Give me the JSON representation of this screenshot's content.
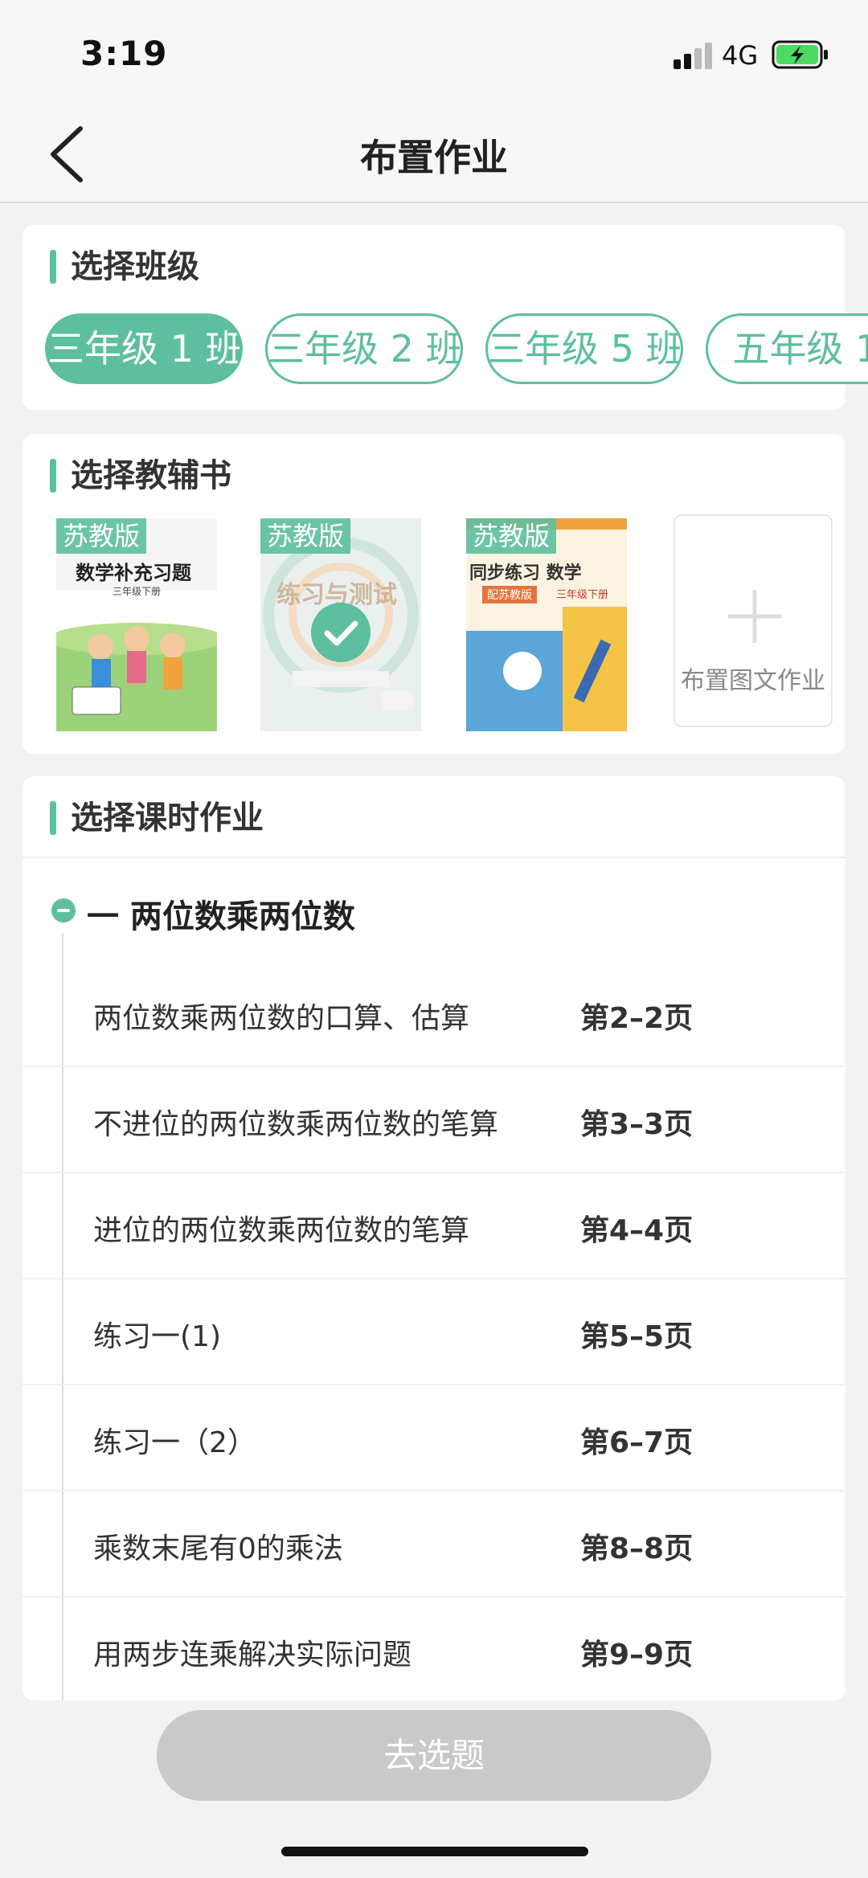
{
  "status_bar": {
    "time": "3:19",
    "network": "4G",
    "signal_icon": "signal-bars-icon",
    "battery_icon": "battery-charging-icon",
    "battery_color": "#4cd964"
  },
  "nav": {
    "title": "布置作业",
    "back_icon": "chevron-left-icon"
  },
  "colors": {
    "accent": "#5dbf9f",
    "button_disabled": "#c9c9c9"
  },
  "class_section": {
    "title": "选择班级",
    "classes": [
      {
        "label": "三年级 1 班",
        "selected": true
      },
      {
        "label": "三年级 2 班",
        "selected": false
      },
      {
        "label": "三年级 5 班",
        "selected": false
      },
      {
        "label": "五年级 1",
        "selected": false
      }
    ]
  },
  "book_section": {
    "title": "选择教辅书",
    "books": [
      {
        "badge": "苏教版",
        "cover_title": "数学补充习题",
        "cover_subtitle": "三年级下册",
        "selected": false
      },
      {
        "badge": "苏教版",
        "cover_title": "练习与测试",
        "selected": true
      },
      {
        "badge": "苏教版",
        "cover_title": "同步练习 数学",
        "cover_subtitle": "三年级下册",
        "cover_tag": "配苏教版",
        "selected": false
      }
    ],
    "add_label": "布置图文作业",
    "add_icon": "plus-icon"
  },
  "lesson_section": {
    "title": "选择课时作业",
    "unit_icon": "collapse-minus-icon",
    "unit_title": "一 两位数乘两位数",
    "lessons": [
      {
        "name": "两位数乘两位数的口算、估算",
        "pages": "第2–2页"
      },
      {
        "name": "不进位的两位数乘两位数的笔算",
        "pages": "第3–3页"
      },
      {
        "name": "进位的两位数乘两位数的笔算",
        "pages": "第4–4页"
      },
      {
        "name": "练习一(1)",
        "pages": "第5–5页"
      },
      {
        "name": "练习一（2）",
        "pages": "第6–7页"
      },
      {
        "name": "乘数末尾有0的乘法",
        "pages": "第8–8页"
      },
      {
        "name": "用两步连乘解决实际问题",
        "pages": "第9–9页"
      }
    ]
  },
  "footer": {
    "go_button": "去选题"
  }
}
